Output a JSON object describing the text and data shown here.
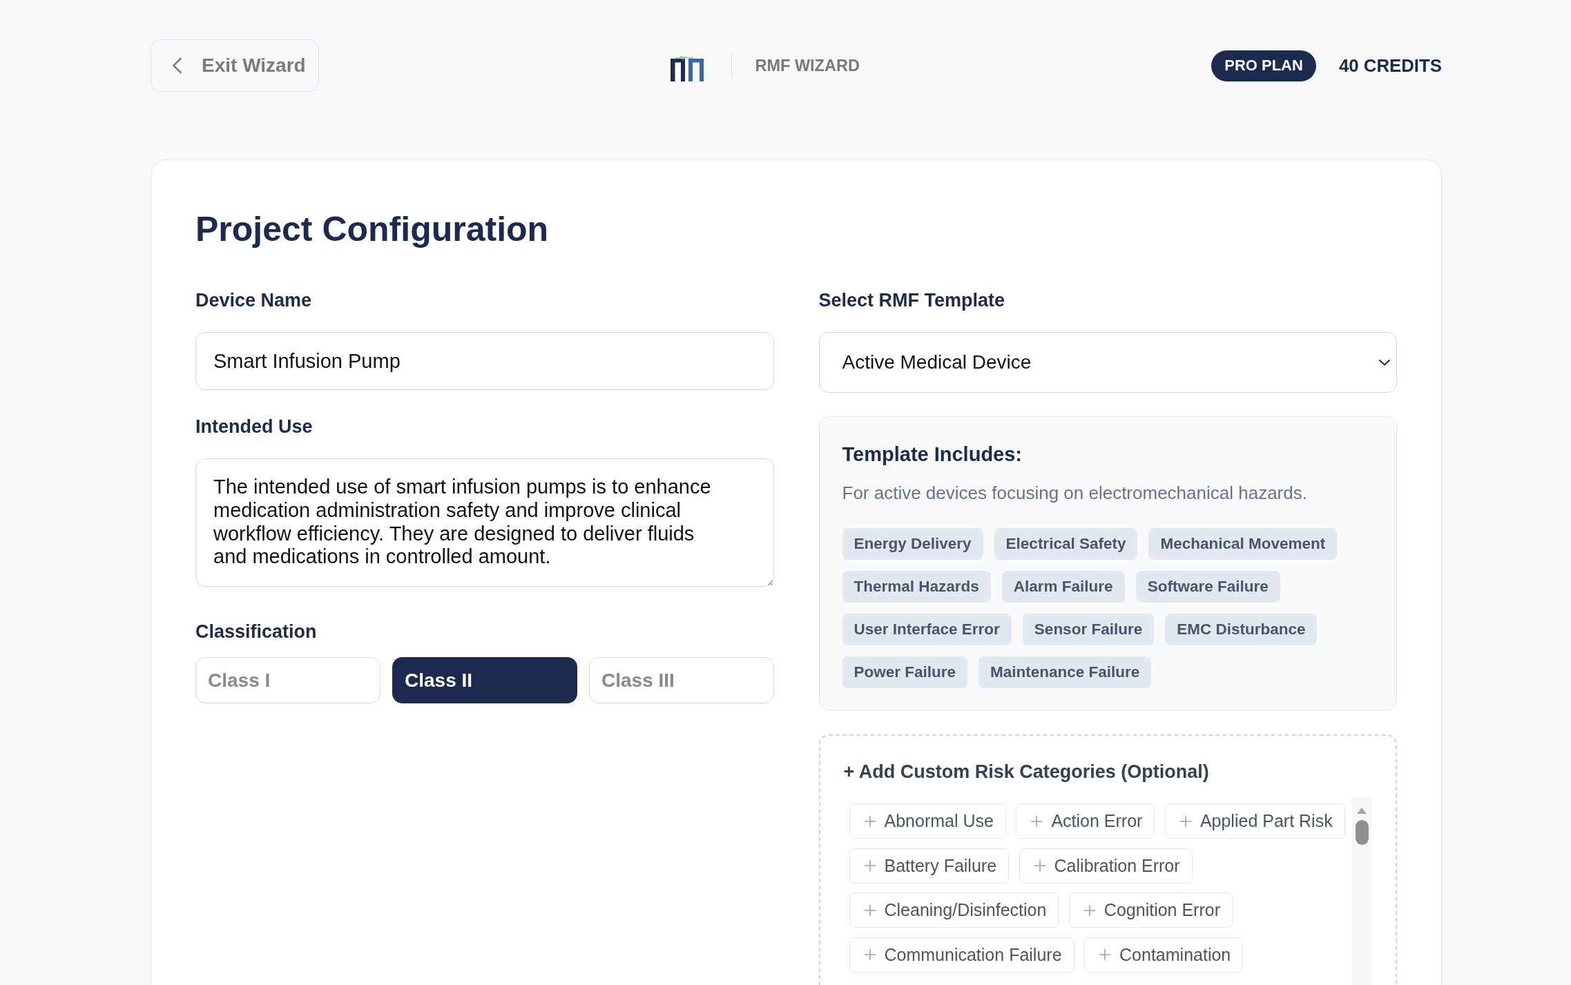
{
  "header": {
    "back_button": {
      "label": "Exit Wizard"
    },
    "product_name": "RMF WIZARD",
    "plan_badge": "PRO PLAN",
    "credits": "40 CREDITS"
  },
  "project_form": {
    "title": "Project Configuration",
    "device_name": {
      "label": "Device Name",
      "value": "Smart Infusion Pump"
    },
    "intended_use": {
      "label": "Intended Use",
      "value": "The intended use of smart infusion pumps is to enhance medication administration safety and improve clinical workflow efficiency. They are designed to deliver fluids and medications in controlled amount."
    },
    "classification": {
      "label": "Classification",
      "options": [
        {
          "label": "Class I",
          "selected": false
        },
        {
          "label": "Class II",
          "selected": true
        },
        {
          "label": "Class III",
          "selected": false
        }
      ]
    },
    "template_select": {
      "label": "Select RMF Template",
      "value": "Active Medical Device"
    },
    "template_includes": {
      "title": "Template Includes:",
      "description": "For active devices focusing on electromechanical hazards.",
      "tags": [
        "Energy Delivery",
        "Electrical Safety",
        "Mechanical Movement",
        "Thermal Hazards",
        "Alarm Failure",
        "Software Failure",
        "User Interface Error",
        "Sensor Failure",
        "EMC Disturbance",
        "Power Failure",
        "Maintenance Failure"
      ]
    },
    "custom_categories": {
      "title": "+ Add Custom Risk Categories (Optional)",
      "options": [
        "Abnormal Use",
        "Action Error",
        "Applied Part Risk",
        "Battery Failure",
        "Calibration Error",
        "Cleaning/Disinfection",
        "Cognition Error",
        "Communication Failure",
        "Contamination"
      ]
    }
  }
}
